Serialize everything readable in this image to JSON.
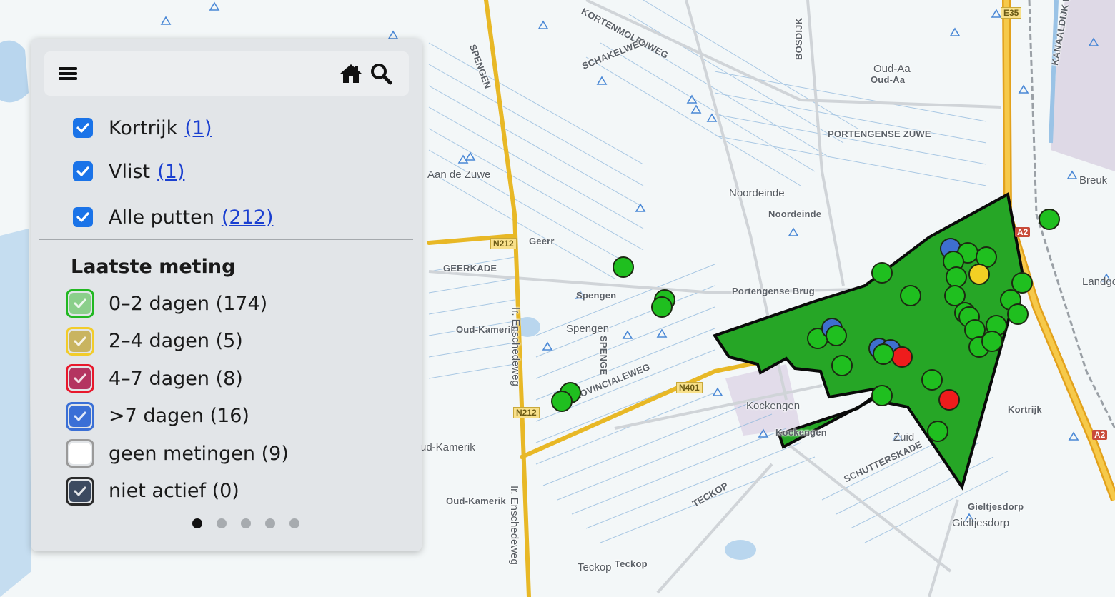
{
  "map": {
    "labels": [
      {
        "text": "KORTENMOLENWEG",
        "style": "boxed",
        "rot": 28
      },
      {
        "text": "Oud-Aa",
        "style": "plain"
      },
      {
        "text": "Oud-Aa",
        "style": "boxed"
      },
      {
        "text": "PORTENGENSE ZUWE",
        "style": "boxed"
      },
      {
        "text": "Aan de Zuwe",
        "style": "plain"
      },
      {
        "text": "Noordeinde",
        "style": "plain"
      },
      {
        "text": "Noordeinde",
        "style": "boxed"
      },
      {
        "text": "N212",
        "style": "road-tag"
      },
      {
        "text": "Geerr",
        "style": "boxed"
      },
      {
        "text": "GEERKADE",
        "style": "boxed"
      },
      {
        "text": "Spengen",
        "style": "boxed"
      },
      {
        "text": "Oud-Kamerik",
        "style": "boxed"
      },
      {
        "text": "Spengen",
        "style": "plain"
      },
      {
        "text": "Portengense Brug",
        "style": "boxed"
      },
      {
        "text": "N401",
        "style": "road-tag"
      },
      {
        "text": "N212",
        "style": "road-tag"
      },
      {
        "text": "PROVINCIALEWEG",
        "style": "boxed",
        "rot": -22
      },
      {
        "text": "Kockengen",
        "style": "plain"
      },
      {
        "text": "Kockengen",
        "style": "boxed"
      },
      {
        "text": "ud-Kamerik",
        "style": "plain"
      },
      {
        "text": "Oud-Kamerik",
        "style": "boxed"
      },
      {
        "text": "TECKOP",
        "style": "boxed",
        "rot": -30
      },
      {
        "text": "SCHUTTERSKADE",
        "style": "boxed",
        "rot": -25
      },
      {
        "text": "Teckop",
        "style": "plain"
      },
      {
        "text": "Teckop",
        "style": "boxed"
      },
      {
        "text": "Gieltjesdorp",
        "style": "boxed"
      },
      {
        "text": "Gieltjesdorp",
        "style": "plain"
      },
      {
        "text": "Kortrijk",
        "style": "boxed"
      },
      {
        "text": "Breuk",
        "style": "plain"
      },
      {
        "text": "Landgoe",
        "style": "plain"
      },
      {
        "text": "Zuid",
        "style": "plain"
      },
      {
        "text": "KANAALDIJK WEST",
        "style": "boxed",
        "rot": -80
      },
      {
        "text": "BOSDIJK",
        "style": "boxed",
        "rot": -90
      },
      {
        "text": "SPENGE",
        "style": "boxed",
        "rot": 90
      },
      {
        "text": "Ir. Enschedeweg",
        "style": "plain",
        "rot": 90
      },
      {
        "text": "Ir. Enschedeweg",
        "style": "plain",
        "rot": 90
      },
      {
        "text": "A2",
        "style": "mway-tag"
      },
      {
        "text": "A2",
        "style": "mway-tag"
      },
      {
        "text": "SPENGEN",
        "style": "boxed",
        "rot": 70
      },
      {
        "text": "E35",
        "style": "road-tag"
      },
      {
        "text": "SCHAKELWEG",
        "style": "boxed",
        "rot": -22
      }
    ],
    "marker_colors": {
      "green": "#1fbf1f",
      "yellow": "#f2d024",
      "red": "#ee1c1c",
      "blue": "#3e6fcf"
    },
    "polygon_color": "#26a626"
  },
  "panel": {
    "toolbar": {
      "menu_icon": "hamburger-menu-icon",
      "home_icon": "home-icon",
      "search_icon": "search-icon"
    },
    "layers": [
      {
        "label": "Kortrijk",
        "count": "(1)",
        "checked": true
      },
      {
        "label": "Vlist",
        "count": "(1)",
        "checked": true
      },
      {
        "label": "Alle putten",
        "count": "(212)",
        "checked": true
      }
    ],
    "legend": {
      "title": "Laatste meting",
      "items": [
        {
          "label": "0–2 dagen (174)",
          "border": "#22b822",
          "fill": "#8bcf8b",
          "checked": true
        },
        {
          "label": "2–4 dagen (5)",
          "border": "#f2cc2a",
          "fill": "#c9b460",
          "checked": true
        },
        {
          "label": "4–7 dagen (8)",
          "border": "#e8182c",
          "fill": "#b43460",
          "checked": true
        },
        {
          "label": ">7 dagen (16)",
          "border": "#3a6fd6",
          "fill": "#3a6fd6",
          "checked": true
        },
        {
          "label": "geen metingen (9)",
          "border": "#9a9a9a",
          "fill": "#ffffff",
          "checked": false
        },
        {
          "label": "niet actief (0)",
          "border": "#2a2a2a",
          "fill": "#3c4a60",
          "checked": true
        }
      ]
    },
    "pager": {
      "pages": 5,
      "active": 1
    }
  }
}
